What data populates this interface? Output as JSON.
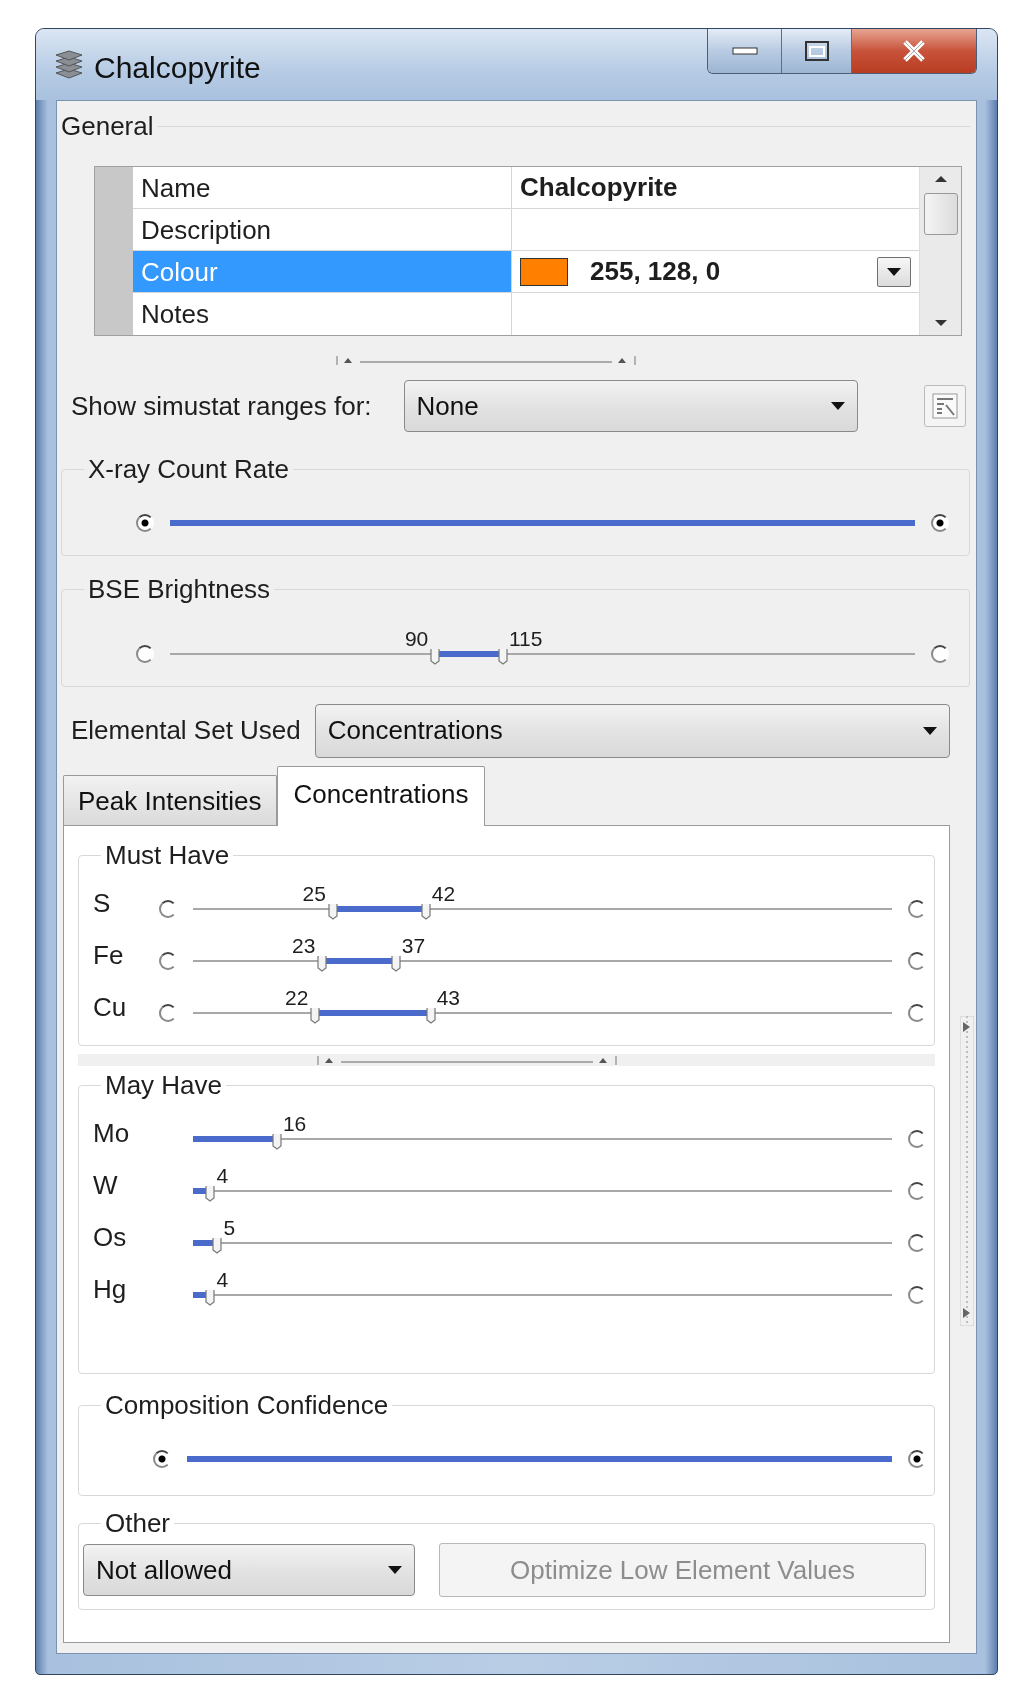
{
  "window": {
    "title": "Chalcopyrite"
  },
  "general": {
    "label": "General",
    "properties": [
      {
        "name": "Name",
        "value": "Chalcopyrite",
        "selected": false,
        "kind": "text"
      },
      {
        "name": "Description",
        "selected": false,
        "kind": "text"
      },
      {
        "name": "Colour",
        "value": "255, 128, 0",
        "color": "#ff8000",
        "selected": true,
        "kind": "color"
      },
      {
        "name": "Notes",
        "selected": false,
        "kind": "text"
      }
    ]
  },
  "simustat": {
    "label": "Show simustat ranges for:",
    "value": "None"
  },
  "xray_count_rate": {
    "label": "X-ray Count Rate",
    "slider": {
      "left_marker": {
        "checked": true
      },
      "right_marker": {
        "checked": true
      }
    }
  },
  "bse_brightness": {
    "label": "BSE Brightness",
    "slider": {
      "left_marker": {
        "checked": false
      },
      "low": {
        "level": 0.356,
        "reading": "90"
      },
      "high": {
        "level": 0.447,
        "reading": "115"
      },
      "right_marker": {
        "checked": false
      }
    }
  },
  "elemental_set": {
    "label": "Elemental Set Used",
    "value": "Concentrations"
  },
  "tabs": [
    {
      "label": "Peak Intensities",
      "selected": false
    },
    {
      "label": "Concentrations",
      "selected": true
    }
  ],
  "must_have": {
    "label": "Must Have",
    "elements": [
      {
        "symbol": "S",
        "slider": {
          "left_marker": {
            "checked": false
          },
          "low": {
            "level": 0.2,
            "reading": "25"
          },
          "high": {
            "level": 0.333,
            "reading": "42"
          },
          "right_marker": {
            "checked": false
          }
        }
      },
      {
        "symbol": "Fe",
        "slider": {
          "left_marker": {
            "checked": false
          },
          "low": {
            "level": 0.185,
            "reading": "23"
          },
          "high": {
            "level": 0.29,
            "reading": "37"
          },
          "right_marker": {
            "checked": false
          }
        }
      },
      {
        "symbol": "Cu",
        "slider": {
          "left_marker": {
            "checked": false
          },
          "low": {
            "level": 0.175,
            "reading": "22"
          },
          "high": {
            "level": 0.34,
            "reading": "43"
          },
          "right_marker": {
            "checked": false
          }
        }
      }
    ]
  },
  "may_have": {
    "label": "May Have",
    "elements": [
      {
        "symbol": "Mo",
        "slider": {
          "high": {
            "level": 0.12,
            "reading": "16"
          },
          "right_marker": {
            "checked": false
          }
        }
      },
      {
        "symbol": "W",
        "slider": {
          "high": {
            "level": 0.025,
            "reading": "4"
          },
          "right_marker": {
            "checked": false
          }
        }
      },
      {
        "symbol": "Os",
        "slider": {
          "high": {
            "level": 0.035,
            "reading": "5"
          },
          "right_marker": {
            "checked": false
          }
        }
      },
      {
        "symbol": "Hg",
        "slider": {
          "high": {
            "level": 0.025,
            "reading": "4"
          },
          "right_marker": {
            "checked": false
          }
        }
      }
    ]
  },
  "composition_confidence": {
    "label": "Composition Confidence",
    "slider": {
      "left_marker": {
        "checked": true
      },
      "right_marker": {
        "checked": true
      }
    }
  },
  "other": {
    "label": "Other",
    "dropdown": {
      "value": "Not allowed"
    },
    "button": {
      "label": "Optimize Low Element Values",
      "disabled": true
    }
  }
}
